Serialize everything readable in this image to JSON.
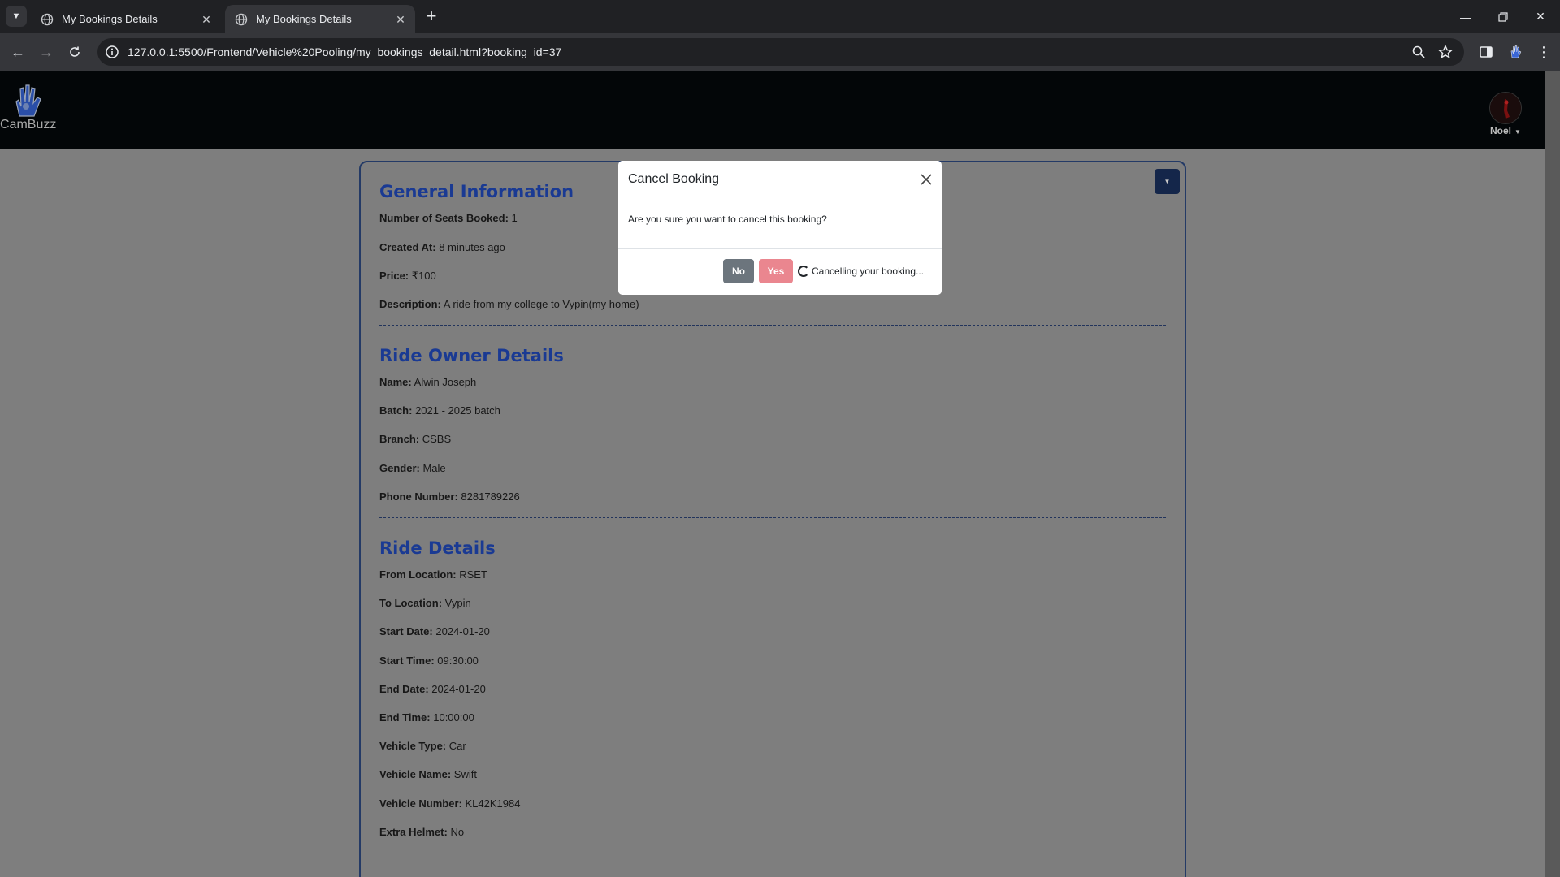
{
  "browser": {
    "tabs": [
      {
        "title": "My Bookings Details",
        "active": false
      },
      {
        "title": "My Bookings Details",
        "active": true
      }
    ],
    "url": "127.0.0.1:5500/Frontend/Vehicle%20Pooling/my_bookings_detail.html?booking_id=37"
  },
  "header": {
    "brand": "CamBuzz",
    "username": "Noel"
  },
  "general": {
    "title": "General Information",
    "fields": [
      {
        "label": "Number of Seats Booked:",
        "value": "1"
      },
      {
        "label": "Created At:",
        "value": "8 minutes ago"
      },
      {
        "label": "Price:",
        "value": "₹100"
      },
      {
        "label": "Description:",
        "value": "A ride from my college to Vypin(my home)"
      }
    ]
  },
  "owner": {
    "title": "Ride Owner Details",
    "fields": [
      {
        "label": "Name:",
        "value": "Alwin Joseph"
      },
      {
        "label": "Batch:",
        "value": "2021 - 2025 batch"
      },
      {
        "label": "Branch:",
        "value": "CSBS"
      },
      {
        "label": "Gender:",
        "value": "Male"
      },
      {
        "label": "Phone Number:",
        "value": "8281789226"
      }
    ]
  },
  "ride": {
    "title": "Ride Details",
    "fields": [
      {
        "label": "From Location:",
        "value": "RSET"
      },
      {
        "label": "To Location:",
        "value": "Vypin"
      },
      {
        "label": "Start Date:",
        "value": "2024-01-20"
      },
      {
        "label": "Start Time:",
        "value": "09:30:00"
      },
      {
        "label": "End Date:",
        "value": "2024-01-20"
      },
      {
        "label": "End Time:",
        "value": "10:00:00"
      },
      {
        "label": "Vehicle Type:",
        "value": "Car"
      },
      {
        "label": "Vehicle Name:",
        "value": "Swift"
      },
      {
        "label": "Vehicle Number:",
        "value": "KL42K1984"
      },
      {
        "label": "Extra Helmet:",
        "value": "No"
      }
    ]
  },
  "modal": {
    "title": "Cancel Booking",
    "body": "Are you sure you want to cancel this booking?",
    "no_label": "No",
    "yes_label": "Yes",
    "status": "Cancelling your booking..."
  },
  "colors": {
    "section_title": "#1a3a93",
    "header_bg": "#030608",
    "overlay_page": "#7e7e7e",
    "btn_no": "#6c757d",
    "btn_yes": "#ea868f"
  }
}
